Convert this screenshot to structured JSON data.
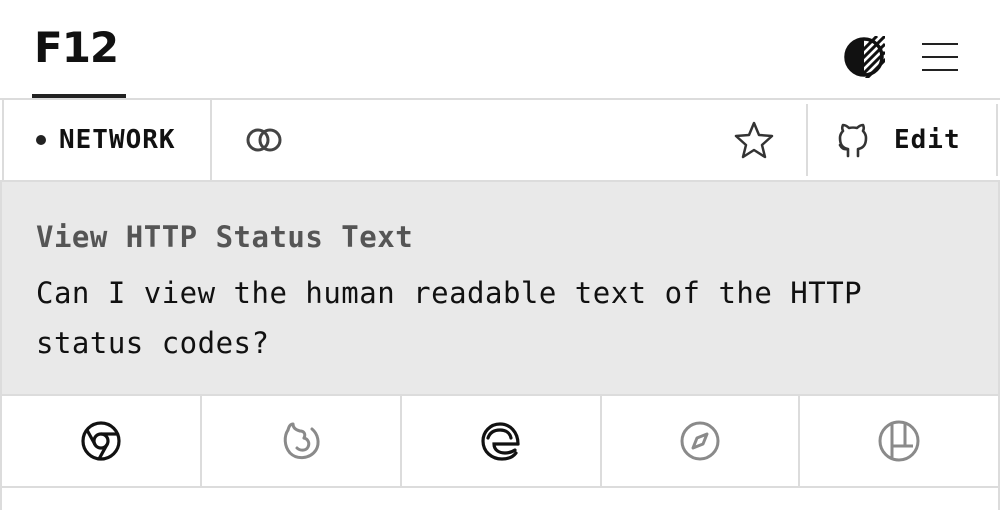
{
  "header": {
    "logo_text": "F12",
    "theme_toggle_icon": "contrast-icon",
    "menu_icon": "hamburger-menu-icon"
  },
  "toolbar": {
    "category_label": "NETWORK",
    "link_icon": "link-icon",
    "star_icon": "star-icon",
    "edit_icon": "github-icon",
    "edit_label": "Edit"
  },
  "tip": {
    "title": "View HTTP Status Text",
    "description": "Can I view the human readable text of the HTTP status codes?"
  },
  "browsers": [
    {
      "name": "Chrome",
      "icon": "chrome-icon",
      "supported": true
    },
    {
      "name": "Firefox",
      "icon": "firefox-icon",
      "supported": false
    },
    {
      "name": "Edge",
      "icon": "edge-icon",
      "supported": true
    },
    {
      "name": "Safari",
      "icon": "safari-icon",
      "supported": false
    },
    {
      "name": "Polypane",
      "icon": "polypane-icon",
      "supported": false
    }
  ],
  "colors": {
    "supported": "#111111",
    "unsupported": "#8a8a8a",
    "content_bg": "#e9e9e9",
    "border": "#dcdcdc"
  }
}
